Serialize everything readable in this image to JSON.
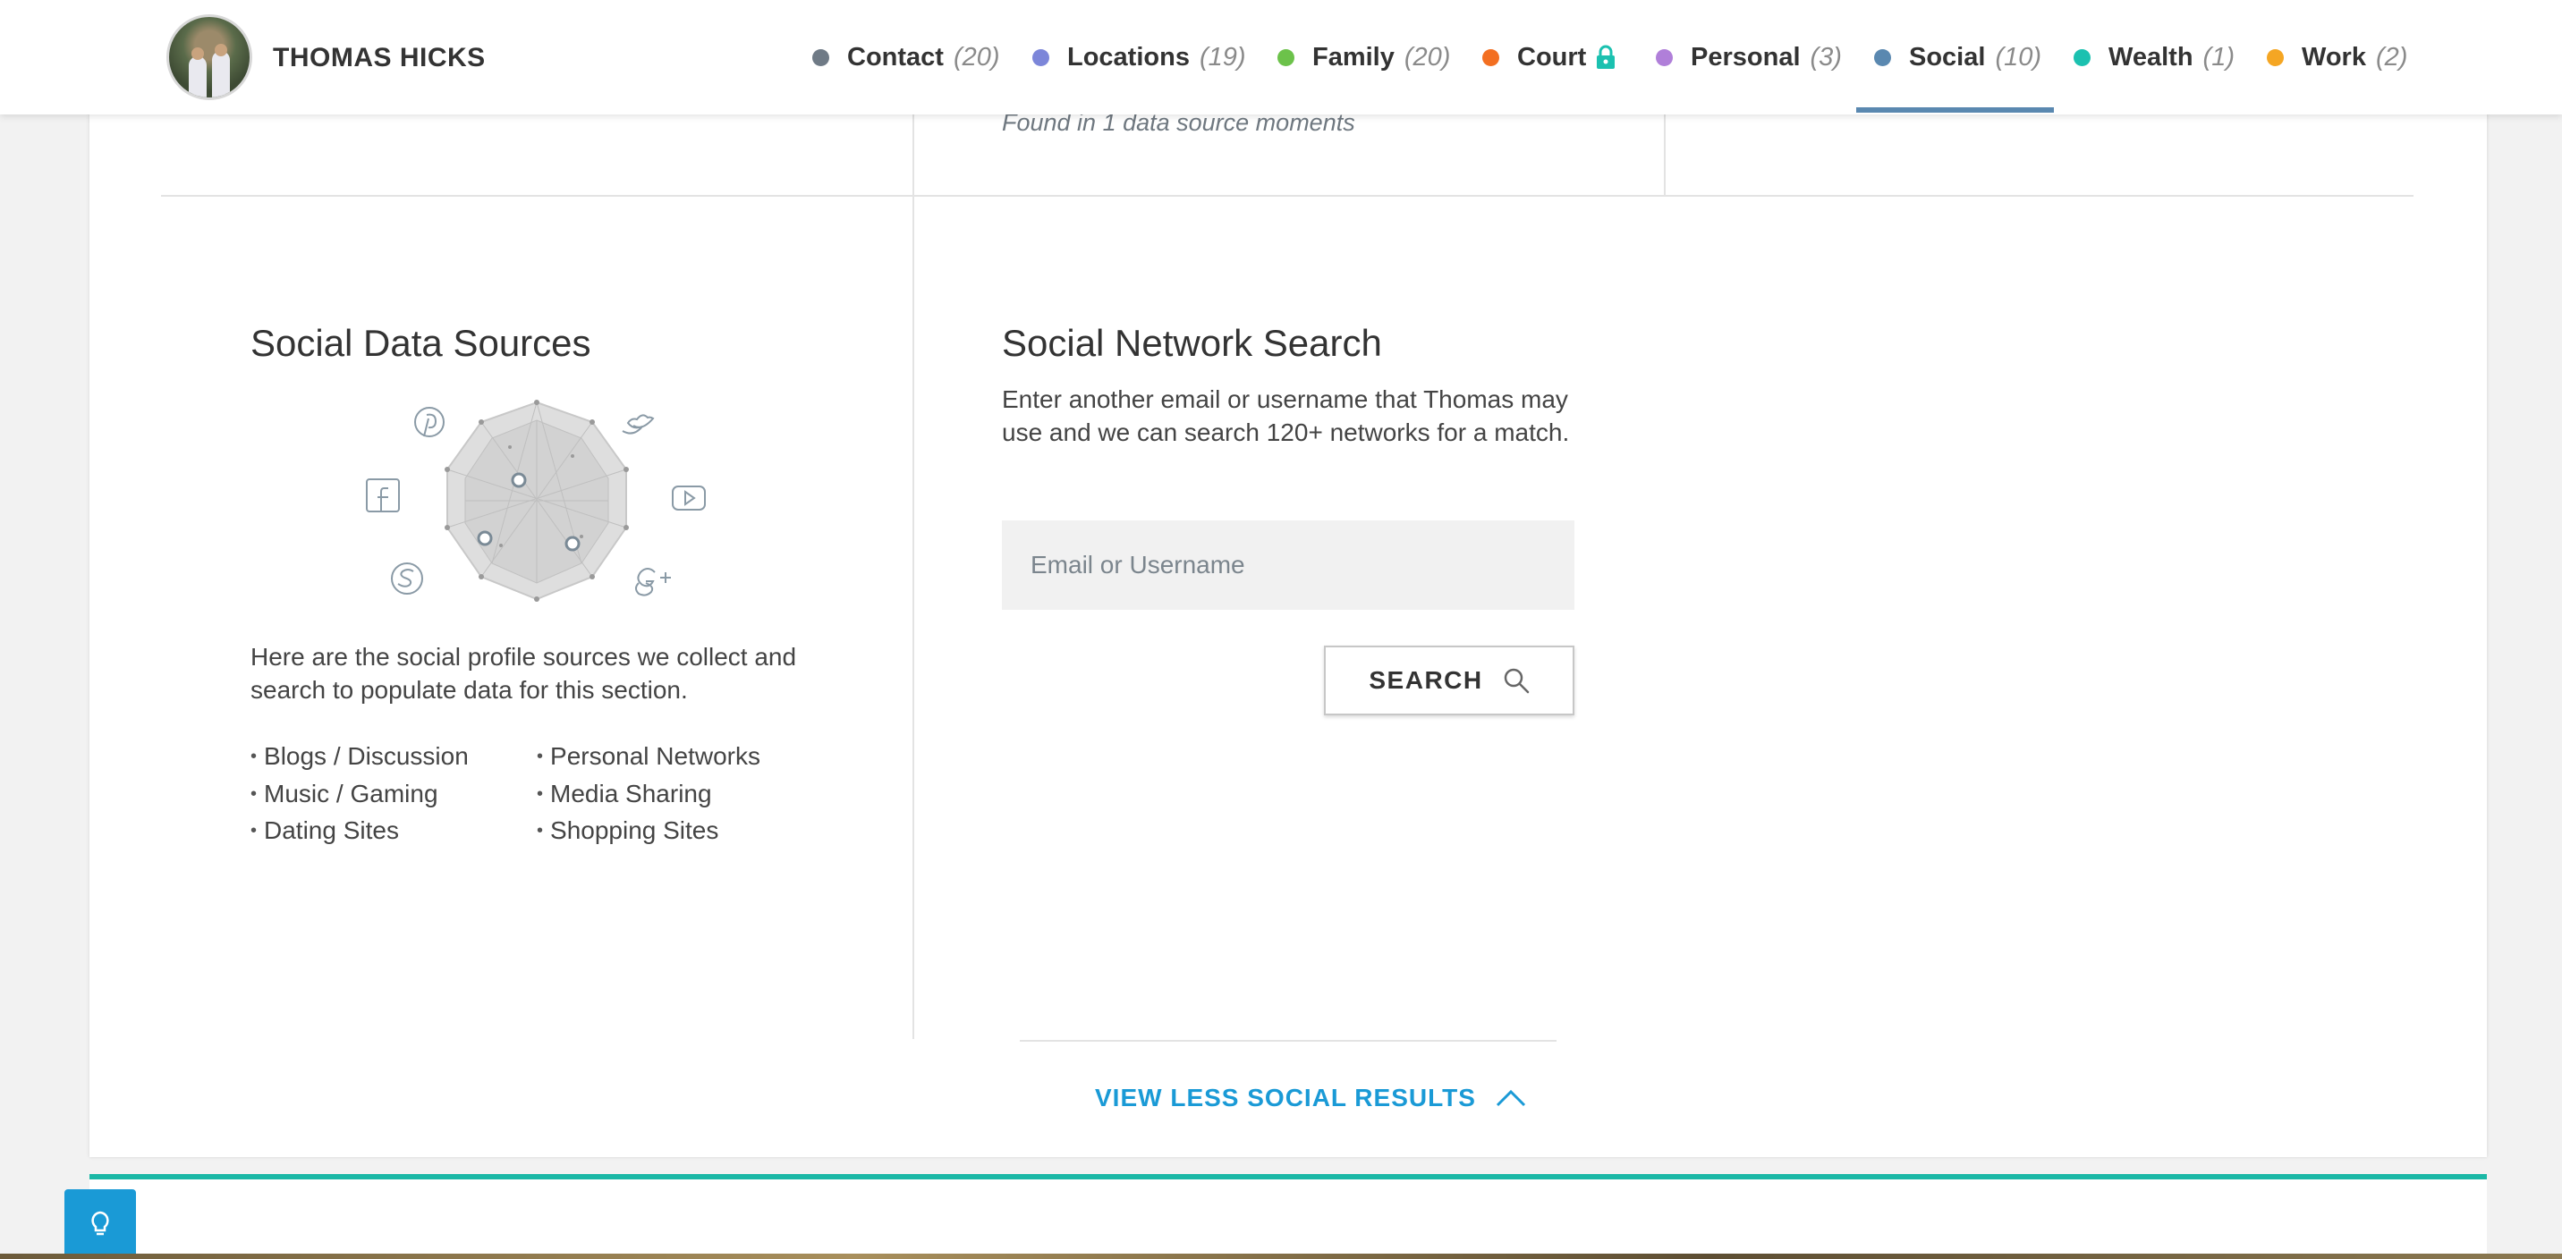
{
  "profile": {
    "name": "THOMAS HICKS"
  },
  "nav": {
    "items": [
      {
        "label": "Contact",
        "count": "(20)",
        "color": "#6f7a86"
      },
      {
        "label": "Locations",
        "count": "(19)",
        "color": "#7c86d9"
      },
      {
        "label": "Family",
        "count": "(20)",
        "color": "#6cc24a"
      },
      {
        "label": "Court",
        "count": "",
        "color": "#f36f21",
        "locked": true,
        "lock_icon": "lock-icon"
      },
      {
        "label": "Personal",
        "count": "(3)",
        "color": "#b07fd9"
      },
      {
        "label": "Social",
        "count": "(10)",
        "color": "#5a88b0",
        "active": true
      },
      {
        "label": "Wealth",
        "count": "(1)",
        "color": "#1bc1b0"
      },
      {
        "label": "Work",
        "count": "(2)",
        "color": "#f5a623"
      }
    ]
  },
  "prev_section": {
    "found_note": "Found in 1 data source moments"
  },
  "sources": {
    "title": "Social Data Sources",
    "icons": [
      "pinterest-icon",
      "twitter-icon",
      "facebook-icon",
      "youtube-icon",
      "skype-icon",
      "google-plus-icon"
    ],
    "description": "Here are the social profile sources we collect and search to populate data for this section.",
    "list_left": [
      "Blogs / Discussion",
      "Music / Gaming",
      "Dating Sites"
    ],
    "list_right": [
      "Personal Networks",
      "Media Sharing",
      "Shopping Sites"
    ]
  },
  "search": {
    "title": "Social Network Search",
    "description": "Enter another email or username that Thomas may use and we can search 120+ networks for a match.",
    "placeholder": "Email or Username",
    "button_label": "SEARCH",
    "button_icon": "search-icon"
  },
  "footer": {
    "view_less_label": "VIEW LESS SOCIAL RESULTS",
    "chevron_icon": "chevron-up-icon",
    "help_icon": "lightbulb-icon"
  },
  "colors": {
    "accent": "#1a9ad6",
    "active_tab": "#5a88b0",
    "teal": "#1bb8a6"
  }
}
